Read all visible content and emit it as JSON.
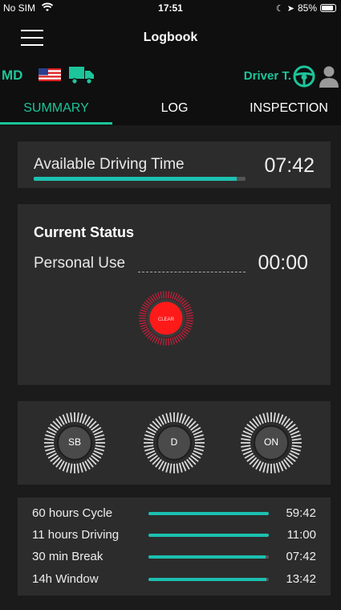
{
  "status_bar": {
    "carrier": "No SIM",
    "time": "17:51",
    "battery": "85%"
  },
  "nav": {
    "title": "Logbook"
  },
  "driver_bar": {
    "state": "MD",
    "driver_name": "Driver T."
  },
  "tabs": [
    {
      "label": "SUMMARY",
      "active": true
    },
    {
      "label": "LOG",
      "active": false
    },
    {
      "label": "INSPECTION",
      "active": false
    }
  ],
  "available_driving": {
    "label": "Available Driving Time",
    "value": "07:42",
    "progress": 0.96
  },
  "current_status": {
    "title": "Current Status",
    "status": "Personal Use",
    "time": "00:00",
    "clear_label": "CLEAR"
  },
  "duty_buttons": [
    {
      "label": "SB"
    },
    {
      "label": "D"
    },
    {
      "label": "ON"
    }
  ],
  "timers": [
    {
      "label": "60 hours Cycle",
      "value": "59:42",
      "progress": 1.0
    },
    {
      "label": "11 hours Driving",
      "value": "11:00",
      "progress": 1.0
    },
    {
      "label": "30 min Break",
      "value": "07:42",
      "progress": 0.97
    },
    {
      "label": "14h Window",
      "value": "13:42",
      "progress": 0.98
    }
  ],
  "colors": {
    "accent": "#1cc59a",
    "progress": "#1cc0b0",
    "clear_red": "#ff1a1a",
    "panel": "#2c2c2c",
    "background": "#1b1b1b"
  }
}
